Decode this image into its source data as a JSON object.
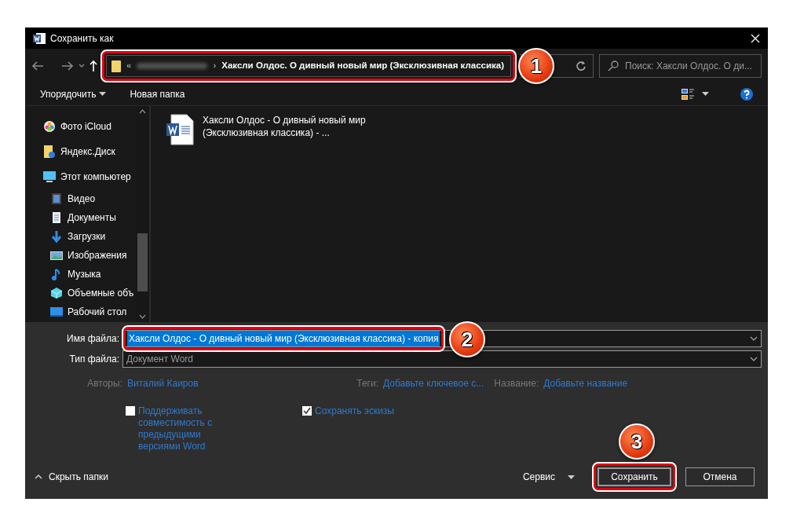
{
  "window": {
    "title": "Сохранить как"
  },
  "address_bar": {
    "highlighted": true,
    "overflow_mark": "«",
    "separator": "›",
    "current": "Хаксли Олдос. О дивный новый мир (Эксклюзивная классика)"
  },
  "search": {
    "placeholder": "Поиск: Хаксли Олдос. О ди..."
  },
  "toolbar": {
    "organize": "Упорядочить",
    "new_folder": "Новая папка"
  },
  "sidebar": {
    "items": [
      {
        "label": "Фото iCloud",
        "kind": "photos"
      },
      {
        "label": "Яндекс.Диск",
        "kind": "cloud"
      },
      {
        "label": "Этот компьютер",
        "kind": "computer",
        "children": [
          {
            "label": "Видео",
            "kind": "video"
          },
          {
            "label": "Документы",
            "kind": "documents"
          },
          {
            "label": "Загрузки",
            "kind": "downloads"
          },
          {
            "label": "Изображения",
            "kind": "pictures"
          },
          {
            "label": "Музыка",
            "kind": "music"
          },
          {
            "label": "Объемные объ",
            "kind": "objects"
          },
          {
            "label": "Рабочий стол",
            "kind": "desktop"
          }
        ]
      }
    ]
  },
  "files": [
    {
      "name": "Хаксли Олдос - О дивный новый мир (Эксклюзивная классика) - ...",
      "kind": "word"
    }
  ],
  "form": {
    "file_name": {
      "label": "Имя файла:",
      "value": "Хаксли Олдос - О дивный новый мир (Эксклюзивная классика) - копия",
      "text_selected": true,
      "highlighted": true
    },
    "file_type": {
      "label": "Тип файла:",
      "value": "Документ Word"
    }
  },
  "metadata": [
    {
      "label": "Авторы:",
      "value": "Виталий Каиров"
    },
    {
      "label": "Теги:",
      "value": "Добавьте ключевое с..."
    },
    {
      "label": "Название:",
      "value": "Добавьте название"
    }
  ],
  "options": [
    {
      "label": "Поддерживать совместимость с предыдущими версиями Word",
      "checked": false
    },
    {
      "label": "Сохранять эскизы",
      "checked": true
    }
  ],
  "footer": {
    "hide_folders": "Скрыть папки",
    "tools": "Сервис",
    "buttons": [
      {
        "label": "Сохранить",
        "kind": "primary",
        "highlighted": true
      },
      {
        "label": "Отмена",
        "kind": "secondary",
        "highlighted": false
      }
    ]
  },
  "callouts": [
    {
      "label": "1"
    },
    {
      "label": "2"
    },
    {
      "label": "3"
    }
  ]
}
